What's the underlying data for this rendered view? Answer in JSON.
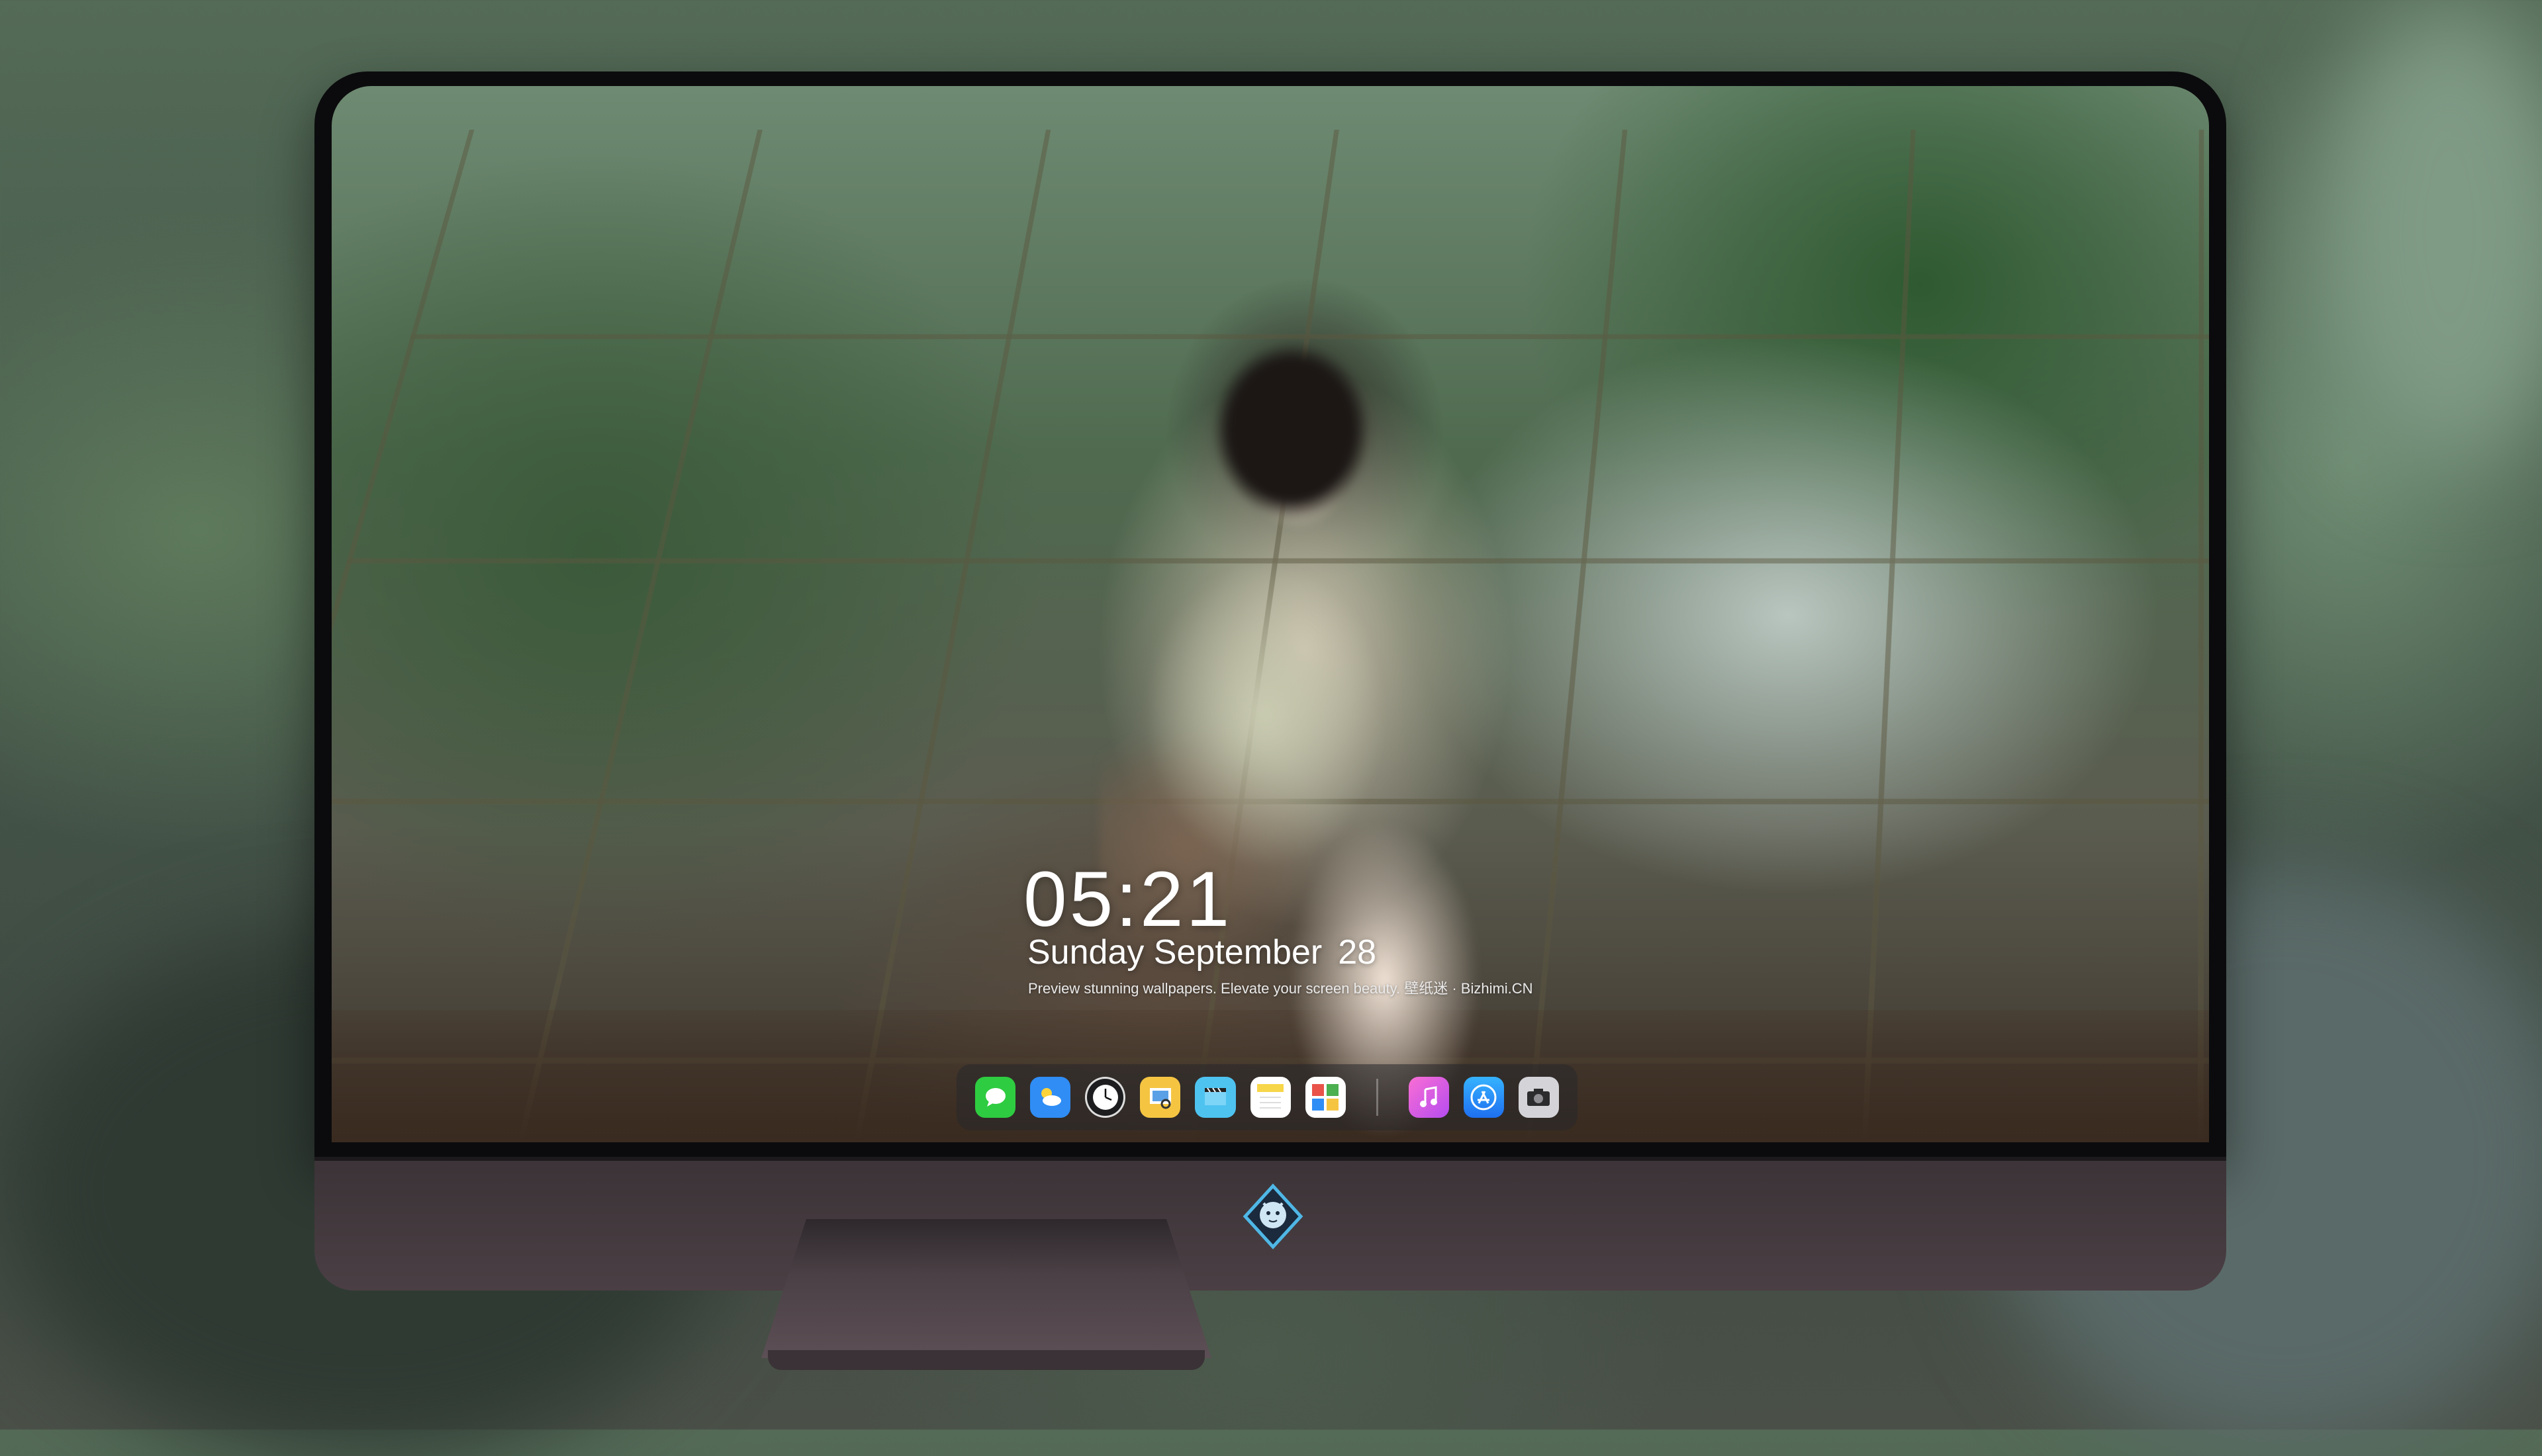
{
  "lock_screen": {
    "time": "05:21",
    "weekday_month": "Sunday September",
    "day": "28",
    "tagline": "Preview stunning wallpapers. Elevate your screen beauty. 壁纸迷 · Bizhimi.CN"
  },
  "dock": {
    "apps": [
      {
        "name": "Messages",
        "icon": "messages-icon",
        "color": "#2ecc40"
      },
      {
        "name": "Weather",
        "icon": "weather-icon",
        "color": "#2f8df5"
      },
      {
        "name": "Clock",
        "icon": "clock-icon",
        "color": "#1d1d1f"
      },
      {
        "name": "Preview",
        "icon": "preview-icon",
        "color": "#f5c542"
      },
      {
        "name": "Clips",
        "icon": "clips-icon",
        "color": "#4ec3f0"
      },
      {
        "name": "Notes",
        "icon": "notes-icon",
        "color": "#f7d64a"
      },
      {
        "name": "Photo Booth",
        "icon": "photo-booth-icon",
        "color": "#e9534a"
      },
      {
        "name": "Music",
        "icon": "music-icon",
        "color": "#f25bd1"
      },
      {
        "name": "App Store",
        "icon": "app-store-icon",
        "color": "#1e8cf8"
      },
      {
        "name": "Camera",
        "icon": "camera-icon",
        "color": "#8e8e93"
      }
    ]
  },
  "brand": {
    "logo": "bizhimi-logo-icon"
  }
}
